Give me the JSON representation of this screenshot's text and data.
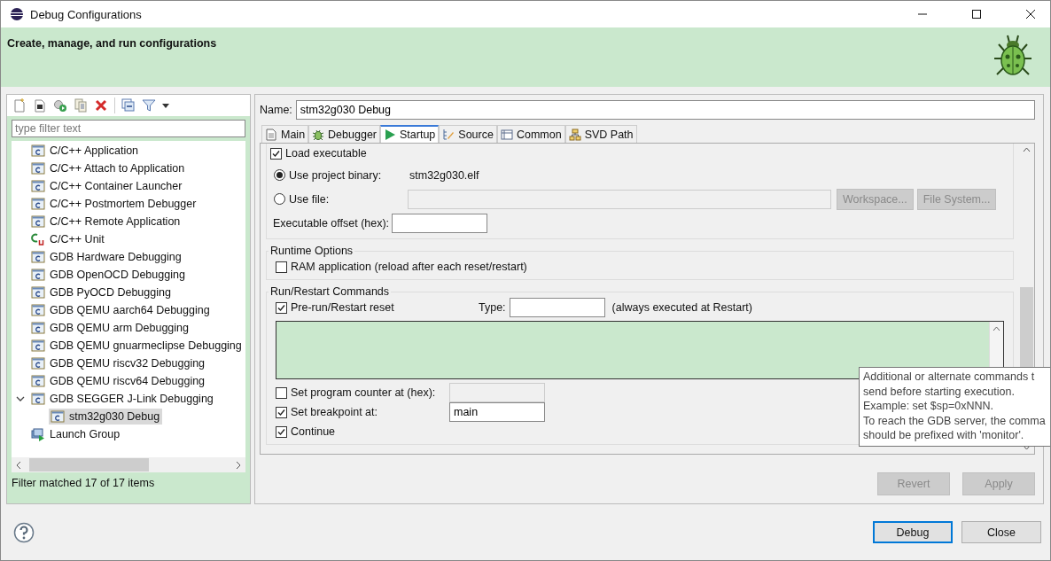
{
  "window": {
    "title": "Debug Configurations"
  },
  "header": {
    "title": "Create, manage, and run configurations"
  },
  "filter": {
    "placeholder": "type filter text"
  },
  "tree": [
    {
      "label": "C/C++ Application",
      "kind": "config",
      "selected": false
    },
    {
      "label": "C/C++ Attach to Application",
      "kind": "config",
      "selected": false
    },
    {
      "label": "C/C++ Container Launcher",
      "kind": "config",
      "selected": false
    },
    {
      "label": "C/C++ Postmortem Debugger",
      "kind": "config",
      "selected": false
    },
    {
      "label": "C/C++ Remote Application",
      "kind": "config",
      "selected": false
    },
    {
      "label": "C/C++ Unit",
      "kind": "unit",
      "selected": false
    },
    {
      "label": "GDB Hardware Debugging",
      "kind": "config",
      "selected": false
    },
    {
      "label": "GDB OpenOCD Debugging",
      "kind": "config",
      "selected": false
    },
    {
      "label": "GDB PyOCD Debugging",
      "kind": "config",
      "selected": false
    },
    {
      "label": "GDB QEMU aarch64 Debugging",
      "kind": "config",
      "selected": false
    },
    {
      "label": "GDB QEMU arm Debugging",
      "kind": "config",
      "selected": false
    },
    {
      "label": "GDB QEMU gnuarmeclipse Debugging",
      "kind": "config",
      "selected": false
    },
    {
      "label": "GDB QEMU riscv32 Debugging",
      "kind": "config",
      "selected": false
    },
    {
      "label": "GDB QEMU riscv64 Debugging",
      "kind": "config",
      "selected": false
    },
    {
      "label": "GDB SEGGER J-Link Debugging",
      "kind": "config",
      "selected": false,
      "expanded": true,
      "children": [
        {
          "label": "stm32g030 Debug",
          "kind": "config",
          "selected": true
        }
      ]
    },
    {
      "label": "Launch Group",
      "kind": "group",
      "selected": false
    }
  ],
  "filter_status": "Filter matched 17 of 17 items",
  "name": {
    "label": "Name:",
    "value": "stm32g030 Debug"
  },
  "tabs": [
    {
      "label": "Main",
      "kind": "main",
      "selected": false
    },
    {
      "label": "Debugger",
      "kind": "debugger",
      "selected": false
    },
    {
      "label": "Startup",
      "kind": "startup",
      "selected": true
    },
    {
      "label": "Source",
      "kind": "source",
      "selected": false
    },
    {
      "label": "Common",
      "kind": "common",
      "selected": false
    },
    {
      "label": "SVD Path",
      "kind": "svd",
      "selected": false
    }
  ],
  "load": {
    "label": "Load executable",
    "checked": true
  },
  "binary_options": [
    {
      "label": "Use project binary:",
      "selected": true,
      "value": "stm32g030.elf"
    },
    {
      "label": "Use file:",
      "selected": false
    }
  ],
  "file_buttons": [
    {
      "label": "Workspace...",
      "disabled": true
    },
    {
      "label": "File System...",
      "disabled": true
    }
  ],
  "offset": {
    "label": "Executable offset (hex):"
  },
  "runtime": {
    "title": "Runtime Options",
    "ram": {
      "label": "RAM application (reload after each reset/restart)",
      "checked": false
    }
  },
  "run_restart": {
    "title": "Run/Restart Commands",
    "reset": {
      "label": "Pre-run/Restart reset",
      "checked": true
    },
    "type_label": "Type:",
    "type_note": "(always executed at Restart)",
    "pc": {
      "label": "Set program counter at (hex):",
      "checked": false
    },
    "breakpoint": {
      "label": "Set breakpoint at:",
      "checked": true,
      "value": "main"
    },
    "continue": {
      "label": "Continue",
      "checked": true
    }
  },
  "tooltip": {
    "lines": [
      "Additional or alternate commands t",
      "send before starting execution.",
      "Example: set $sp=0xNNN.",
      "To reach the GDB server, the comma",
      "should be prefixed with 'monitor'."
    ]
  },
  "actions": [
    {
      "label": "Revert",
      "disabled": true
    },
    {
      "label": "Apply",
      "disabled": true
    }
  ],
  "dialog_buttons": [
    {
      "label": "Debug",
      "default": true
    },
    {
      "label": "Close",
      "default": false
    }
  ]
}
